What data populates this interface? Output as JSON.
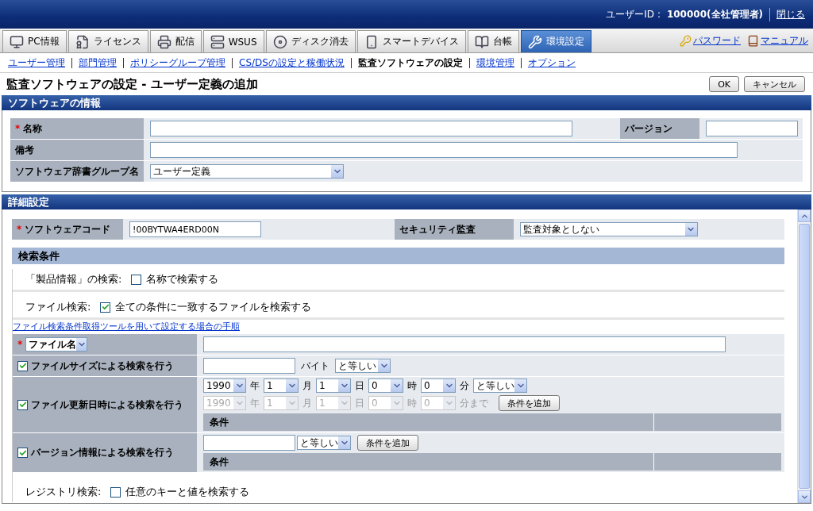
{
  "header": {
    "user_id_label": "ユーザーID :",
    "user_id": "100000(全社管理者)",
    "close_link": "閉じる"
  },
  "tabs": [
    {
      "label": "PC情報",
      "selected": false
    },
    {
      "label": "ライセンス",
      "selected": false
    },
    {
      "label": "配信",
      "selected": false
    },
    {
      "label": "WSUS",
      "selected": false
    },
    {
      "label": "ディスク消去",
      "selected": false
    },
    {
      "label": "スマートデバイス",
      "selected": false
    },
    {
      "label": "台帳",
      "selected": false
    },
    {
      "label": "環境設定",
      "selected": true
    }
  ],
  "tab_links": [
    "パスワード",
    "マニュアル"
  ],
  "subnav": [
    {
      "label": "ユーザー管理",
      "selected": false
    },
    {
      "label": "部門管理",
      "selected": false
    },
    {
      "label": "ポリシーグループ管理",
      "selected": false
    },
    {
      "label": "CS/DSの設定と稼働状況",
      "selected": false
    },
    {
      "label": "監査ソフトウェアの設定",
      "selected": true
    },
    {
      "label": "環境管理",
      "selected": false
    },
    {
      "label": "オプション",
      "selected": false
    }
  ],
  "page_title": "監査ソフトウェアの設定 - ユーザー定義の追加",
  "buttons": [
    "OK",
    "キャンセル"
  ],
  "software_info": {
    "title": "ソフトウェアの情報",
    "name": {
      "label": "名称",
      "required_mark": "*"
    },
    "version": {
      "label": "バージョン"
    },
    "remarks": {
      "label": "備考"
    },
    "group": {
      "label": "ソフトウェア辞書グループ名",
      "value": "ユーザー定義"
    }
  },
  "details": {
    "title": "詳細設定",
    "code": {
      "label": "ソフトウェアコード",
      "required_mark": "*",
      "value": "!00BYTWA4ERD00N"
    },
    "security": {
      "label": "セキュリティ監査",
      "value": "監査対象としない"
    },
    "search_title": "検索条件",
    "product_search": {
      "label": "「製品情報」の検索:",
      "option": "名称で検索する",
      "checked": false
    },
    "file_search": {
      "label": "ファイル検索:",
      "option": "全ての条件に一致するファイルを検索する",
      "checked": true
    },
    "help_link": "ファイル検索条件取得ツールを用いて設定する場合の手順",
    "file_name": {
      "required_mark": "*",
      "select": "ファイル名"
    },
    "file_size": {
      "label": "ファイルサイズによる検索を行う",
      "checked": true,
      "unit": "バイト",
      "compare": "と等しい"
    },
    "file_date": {
      "label": "ファイル更新日時による検索を行う",
      "checked": true,
      "from": [
        {
          "value": "1990",
          "unit": "年"
        },
        {
          "value": "1",
          "unit": "月"
        },
        {
          "value": "1",
          "unit": "日"
        },
        {
          "value": "0",
          "unit": "時"
        },
        {
          "value": "0",
          "unit": "分"
        }
      ],
      "compare": "と等しい",
      "to": [
        {
          "value": "1990",
          "unit": "年"
        },
        {
          "value": "1",
          "unit": "月"
        },
        {
          "value": "1",
          "unit": "日"
        },
        {
          "value": "0",
          "unit": "時"
        },
        {
          "value": "0",
          "unit": "分まで"
        }
      ],
      "to_disabled": true,
      "add_button": "条件を追加",
      "list_header": "条件"
    },
    "version_info": {
      "label": "バージョン情報による検索を行う",
      "checked": true,
      "compare": "と等しい",
      "add_button": "条件を追加",
      "list_header": "条件"
    },
    "registry_search": {
      "label": "レジストリ検索:",
      "option": "任意のキーと値を検索する",
      "checked": false
    }
  }
}
